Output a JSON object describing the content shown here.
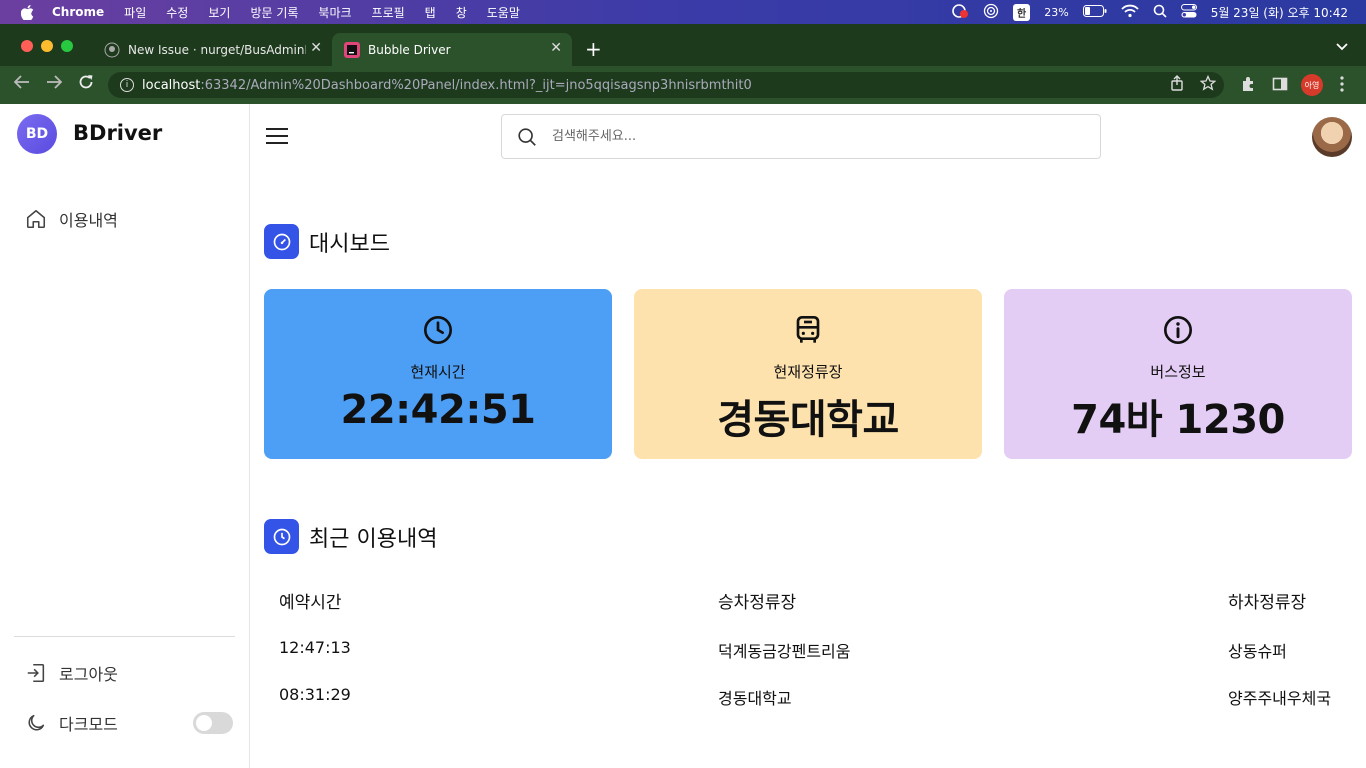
{
  "mac_menubar": {
    "app": "Chrome",
    "items": [
      "파일",
      "수정",
      "보기",
      "방문 기록",
      "북마크",
      "프로필",
      "탭",
      "창",
      "도움말"
    ],
    "input_method": "한",
    "battery": "23%",
    "datetime": "5월 23일 (화) 오후 10:42"
  },
  "browser": {
    "tabs": [
      {
        "title": "New Issue · nurget/BusAdminP"
      },
      {
        "title": "Bubble Driver"
      }
    ],
    "url_host": "localhost",
    "url_rest": ":63342/Admin%20Dashboard%20Panel/index.html?_ijt=jno5qqisagsnp3hnisrbmthit0",
    "profile_label": "아영"
  },
  "sidebar": {
    "logo_text": "BD",
    "brand": "BDriver",
    "nav": [
      {
        "label": "이용내역",
        "icon": "home-icon"
      }
    ],
    "logout_label": "로그아웃",
    "darkmode_label": "다크모드",
    "darkmode_on": false
  },
  "header": {
    "search_placeholder": "검색해주세요..."
  },
  "dashboard": {
    "title": "대시보드",
    "cards": [
      {
        "title": "현재시간",
        "value": "22:42:51",
        "icon": "clock-icon",
        "color": "#4d9ef5"
      },
      {
        "title": "현재정류장",
        "value": "경동대학교",
        "icon": "bus-icon",
        "color": "#fde2ae"
      },
      {
        "title": "버스정보",
        "value": "74바 1230",
        "icon": "info-icon",
        "color": "#e4cdf4"
      }
    ]
  },
  "recent": {
    "title": "최근 이용내역",
    "columns": [
      "예약시간",
      "승차정류장",
      "하차정류장"
    ],
    "rows": [
      [
        "12:47:13",
        "덕계동금강펜트리움",
        "상동슈퍼"
      ],
      [
        "08:31:29",
        "경동대학교",
        "양주주내우체국"
      ]
    ]
  },
  "colors": {
    "accent": "#3354e6",
    "browser_frame": "#2c522c"
  }
}
